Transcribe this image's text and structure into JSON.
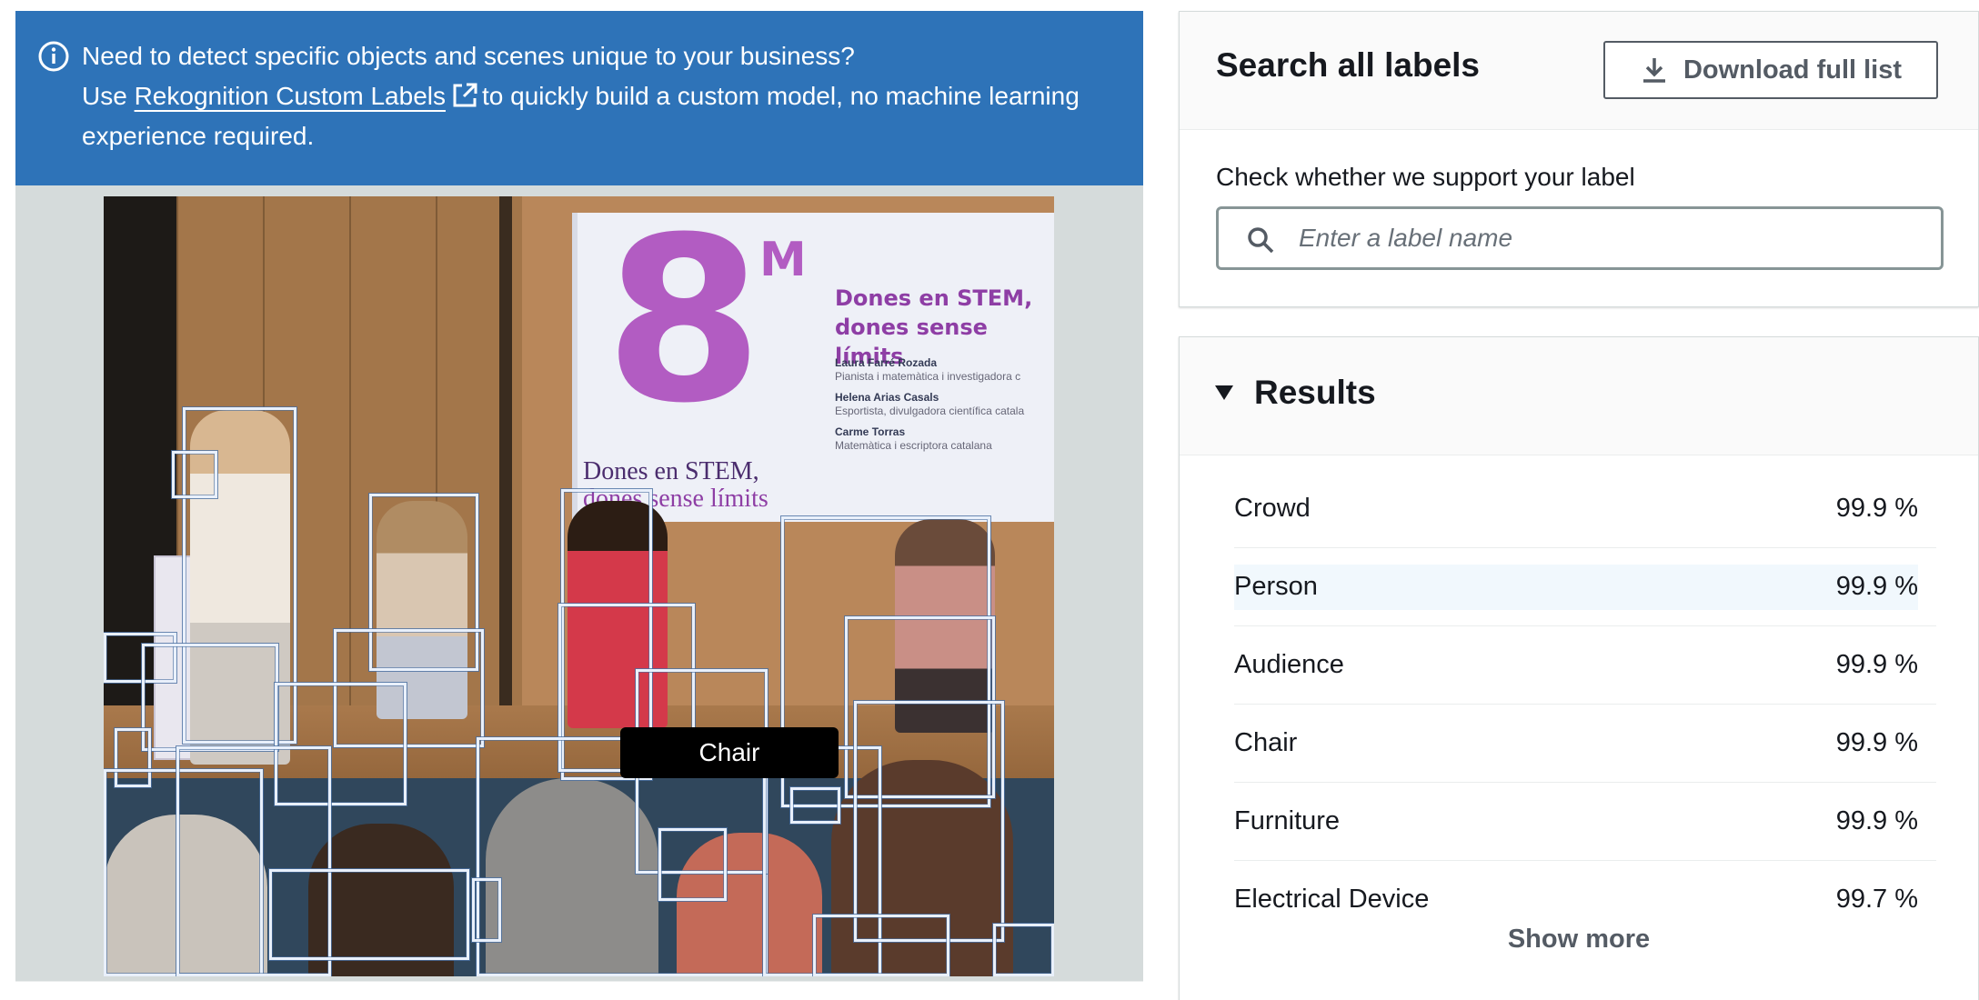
{
  "banner": {
    "line1": "Need to detect specific objects and scenes unique to your business?",
    "prefix": "Use",
    "link_label": "Rekognition Custom Labels",
    "suffix": "to quickly build a custom model, no machine learning experience required."
  },
  "image": {
    "tooltip_label": "Chair",
    "slide_big_number": "8",
    "slide_superscript": "M",
    "slide_title": "Dones en STEM, dones sense límits",
    "slide_footer_title": "Dones en STEM,",
    "slide_footer_title2": "dones sense límits",
    "slide_speakers": [
      {
        "name": "Laura Farré Rozada",
        "role": "Pianista i matemàtica i investigadora c"
      },
      {
        "name": "Helena Arias Casals",
        "role": "Esportista, divulgadora científica catala"
      },
      {
        "name": "Carme Torras",
        "role": "Matemàtica i escriptora catalana"
      }
    ]
  },
  "search": {
    "title": "Search all labels",
    "download_label": "Download full list",
    "check_label": "Check whether we support your label",
    "input_placeholder": "Enter a label name",
    "input_value": ""
  },
  "results": {
    "title": "Results",
    "items": [
      {
        "label": "Crowd",
        "confidence": "99.9 %"
      },
      {
        "label": "Person",
        "confidence": "99.9 %"
      },
      {
        "label": "Audience",
        "confidence": "99.9 %"
      },
      {
        "label": "Chair",
        "confidence": "99.9 %"
      },
      {
        "label": "Furniture",
        "confidence": "99.9 %"
      },
      {
        "label": "Electrical Device",
        "confidence": "99.7 %"
      }
    ],
    "show_more_label": "Show more"
  },
  "icons": {
    "info": "info-icon",
    "external_link": "external-link-icon",
    "download": "download-icon",
    "search": "search-icon",
    "caret": "caret-down-icon"
  },
  "colors": {
    "banner_bg": "#2e73b8",
    "tooltip_bg": "#000000",
    "highlight_row": "#f1f8fd"
  }
}
